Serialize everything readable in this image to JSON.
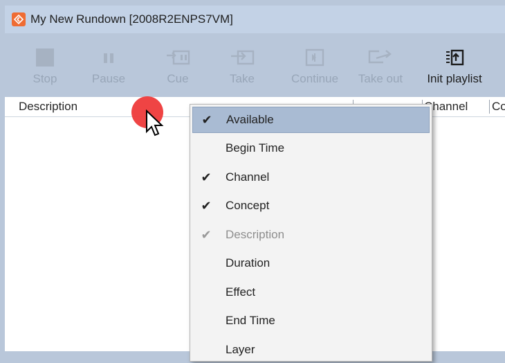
{
  "window": {
    "title": "My New Rundown [2008R2ENPS7VM]",
    "accent": "#ef6c33"
  },
  "toolbar": {
    "buttons": [
      {
        "label": "Stop",
        "icon": "stop-icon",
        "enabled": false
      },
      {
        "label": "Pause",
        "icon": "pause-icon",
        "enabled": false
      },
      {
        "label": "Cue",
        "icon": "cue-icon",
        "enabled": false
      },
      {
        "label": "Take",
        "icon": "take-icon",
        "enabled": false
      },
      {
        "label": "Continue",
        "icon": "continue-icon",
        "enabled": false
      },
      {
        "label": "Take out",
        "icon": "take-out-icon",
        "enabled": false
      },
      {
        "label": "Init playlist",
        "icon": "init-playlist-icon",
        "enabled": true
      }
    ]
  },
  "columns": {
    "description": "Description",
    "available": "Available",
    "channel": "Channel",
    "concept": "Concept"
  },
  "context_menu": {
    "items": [
      {
        "label": "Available",
        "checked": true,
        "enabled": true,
        "highlighted": true
      },
      {
        "label": "Begin Time",
        "checked": false,
        "enabled": true
      },
      {
        "label": "Channel",
        "checked": true,
        "enabled": true
      },
      {
        "label": "Concept",
        "checked": true,
        "enabled": true
      },
      {
        "label": "Description",
        "checked": true,
        "enabled": false
      },
      {
        "label": "Duration",
        "checked": false,
        "enabled": true
      },
      {
        "label": "Effect",
        "checked": false,
        "enabled": true
      },
      {
        "label": "End Time",
        "checked": false,
        "enabled": true
      },
      {
        "label": "Layer",
        "checked": false,
        "enabled": true
      }
    ]
  }
}
